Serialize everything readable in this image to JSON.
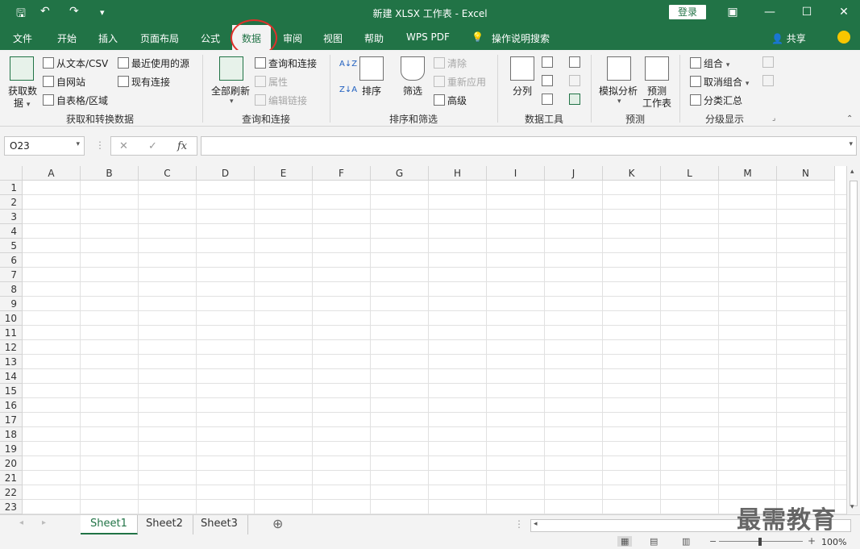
{
  "window": {
    "title": "新建 XLSX 工作表  -  Excel",
    "login_label": "登录",
    "min": "—",
    "max": "☐",
    "close": "✕",
    "restore": "▣"
  },
  "quick_access": {
    "save": "🖫",
    "undo": "↶",
    "redo": "↷",
    "customize": "▾"
  },
  "tabs": [
    "文件",
    "开始",
    "插入",
    "页面布局",
    "公式",
    "数据",
    "审阅",
    "视图",
    "帮助",
    "WPS PDF",
    "操作说明搜索"
  ],
  "active_tab": "数据",
  "share_label": "共享",
  "ribbon": {
    "get_transform": {
      "label": "获取和转换数据",
      "get_data_1": "获取数",
      "get_data_2": "据",
      "from_text": "从文本/CSV",
      "from_web": "自网站",
      "from_table": "自表格/区域",
      "recent_sources": "最近使用的源",
      "existing_connections": "现有连接"
    },
    "queries": {
      "label": "查询和连接",
      "refresh_all": "全部刷新",
      "queries_connections": "查询和连接",
      "properties": "属性",
      "edit_links": "编辑链接"
    },
    "sort_filter": {
      "label": "排序和筛选",
      "sort": "排序",
      "filter": "筛选",
      "clear": "清除",
      "reapply": "重新应用",
      "advanced": "高级"
    },
    "data_tools": {
      "label": "数据工具",
      "split": "分列"
    },
    "forecast": {
      "label": "预测",
      "what_if": "模拟分析",
      "forecast_sheet_1": "预测",
      "forecast_sheet_2": "工作表"
    },
    "outline": {
      "label": "分级显示",
      "group": "组合",
      "ungroup": "取消组合",
      "subtotal": "分类汇总"
    }
  },
  "formula_bar": {
    "name_box": "O23",
    "cancel": "✕",
    "enter": "✓",
    "fx": "fx",
    "value": ""
  },
  "columns": [
    "A",
    "B",
    "C",
    "D",
    "E",
    "F",
    "G",
    "H",
    "I",
    "J",
    "K",
    "L",
    "M",
    "N"
  ],
  "rows": [
    "1",
    "2",
    "3",
    "4",
    "5",
    "6",
    "7",
    "8",
    "9",
    "10",
    "11",
    "12",
    "13",
    "14",
    "15",
    "16",
    "17",
    "18",
    "19",
    "20",
    "21",
    "22",
    "23"
  ],
  "sheets": [
    "Sheet1",
    "Sheet2",
    "Sheet3"
  ],
  "active_sheet": "Sheet1",
  "add_sheet": "⊕",
  "zoom": "100%",
  "watermark": "最需教育"
}
